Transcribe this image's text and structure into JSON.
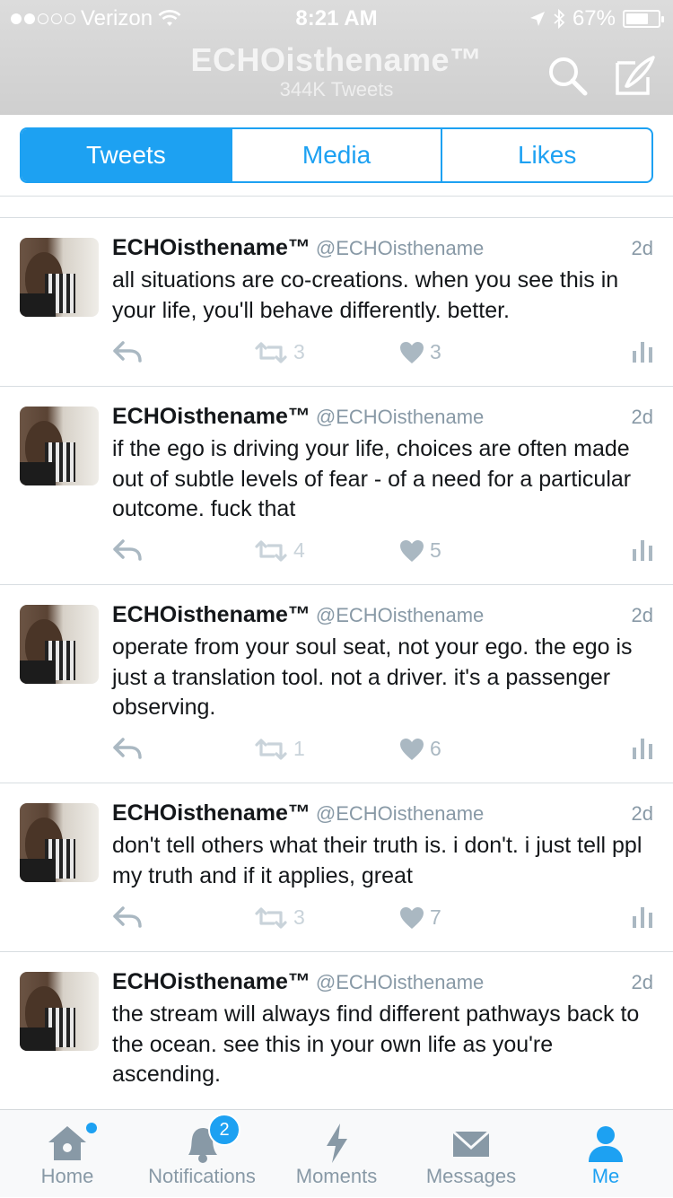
{
  "status_bar": {
    "carrier": "Verizon",
    "time": "8:21 AM",
    "battery": "67%"
  },
  "header": {
    "title": "ECHOisthename™",
    "subtitle": "344K Tweets",
    "search_icon": "search-icon",
    "compose_icon": "compose-icon"
  },
  "tabs": [
    {
      "label": "Tweets",
      "active": true
    },
    {
      "label": "Media",
      "active": false
    },
    {
      "label": "Likes",
      "active": false
    }
  ],
  "tweets": [
    {
      "name": "ECHOisthename™",
      "handle": "@ECHOisthename",
      "time": "2d",
      "text": "all situations are co-creations. when you see this in your life, you'll behave differently. better.",
      "retweets": "3",
      "likes": "3"
    },
    {
      "name": "ECHOisthename™",
      "handle": "@ECHOisthename",
      "time": "2d",
      "text": "if the ego is driving your life, choices are often made out of subtle levels of fear - of a need for a particular outcome. fuck that",
      "retweets": "4",
      "likes": "5"
    },
    {
      "name": "ECHOisthename™",
      "handle": "@ECHOisthename",
      "time": "2d",
      "text": "operate from your soul seat, not your ego. the ego is just a translation tool. not a driver. it's a passenger observing.",
      "retweets": "1",
      "likes": "6"
    },
    {
      "name": "ECHOisthename™",
      "handle": "@ECHOisthename",
      "time": "2d",
      "text": "don't tell others what their truth is. i don't. i just tell ppl my truth and if it applies, great",
      "retweets": "3",
      "likes": "7"
    },
    {
      "name": "ECHOisthename™",
      "handle": "@ECHOisthename",
      "time": "2d",
      "text": "the stream will always find different pathways back to the ocean. see this in your own life as you're ascending.",
      "retweets": "",
      "likes": ""
    }
  ],
  "tabbar": [
    {
      "label": "Home",
      "icon": "home-icon"
    },
    {
      "label": "Notifications",
      "icon": "bell-icon",
      "badge": "2"
    },
    {
      "label": "Moments",
      "icon": "lightning-icon"
    },
    {
      "label": "Messages",
      "icon": "envelope-icon"
    },
    {
      "label": "Me",
      "icon": "person-icon",
      "active": true
    }
  ],
  "colors": {
    "accent": "#1da1f2",
    "muted": "#8899a6",
    "icon_gray": "#aab8c2"
  }
}
